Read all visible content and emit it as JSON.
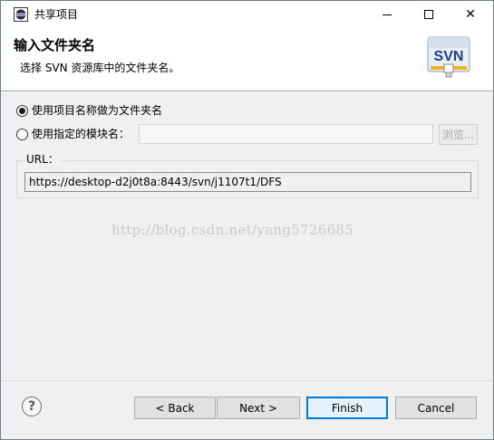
{
  "window": {
    "title": "共享项目",
    "minimize_label": "",
    "close_label": "✕"
  },
  "header": {
    "title": "输入文件夹名",
    "description": "选择 SVN 资源库中的文件夹名。",
    "logo_text": "SVN"
  },
  "options": {
    "use_project_name": "使用项目名称做为文件夹名",
    "use_module_name": "使用指定的模块名：",
    "selected": "use_project_name",
    "module_name_value": "",
    "browse_label": "浏览..."
  },
  "url": {
    "label": "URL：",
    "value": "https://desktop-d2j0t8a:8443/svn/j1107t1/DFS"
  },
  "watermark": "http://blog.csdn.net/yang5726685",
  "footer": {
    "help_label": "?",
    "back_label": "< Back",
    "next_label": "Next >",
    "finish_label": "Finish",
    "cancel_label": "Cancel"
  },
  "colors": {
    "accent": "#0078d7",
    "panel": "#f0f0f0"
  }
}
